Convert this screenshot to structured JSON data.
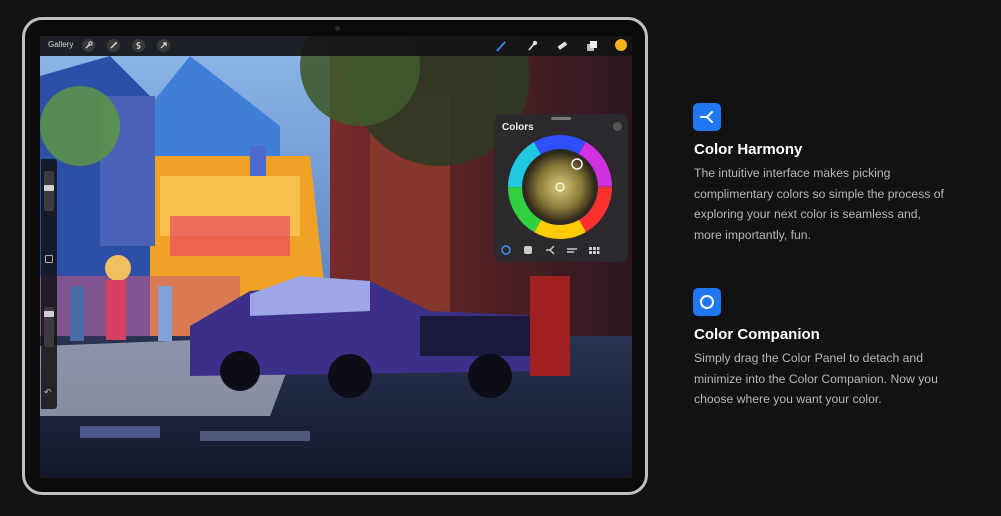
{
  "toolbar": {
    "gallery_label": "Gallery",
    "left_icons": [
      "wrench-icon",
      "magic-wand-icon",
      "selection-icon",
      "transform-arrow-icon"
    ],
    "right_icons": [
      "brush-icon",
      "smudge-icon",
      "eraser-icon",
      "layers-icon"
    ],
    "active_color": "#f2b320"
  },
  "colors_panel": {
    "title": "Colors",
    "tabs": [
      "disc-icon",
      "classic-icon",
      "harmony-icon",
      "value-icon",
      "palettes-icon"
    ]
  },
  "features": [
    {
      "icon": "harmony-icon",
      "title": "Color Harmony",
      "lines": [
        "The intuitive interface makes picking",
        "complimentary colors so simple the process of",
        "exploring your next color is seamless and,",
        "more importantly, fun."
      ]
    },
    {
      "icon": "color-companion-icon",
      "title": "Color Companion",
      "lines": [
        "Simply drag the Color Panel to detach and",
        "minimize into the Color Companion. Now you",
        "choose where you want your color."
      ]
    }
  ],
  "colors": {
    "accent": "#2176f2",
    "background": "#121212"
  }
}
